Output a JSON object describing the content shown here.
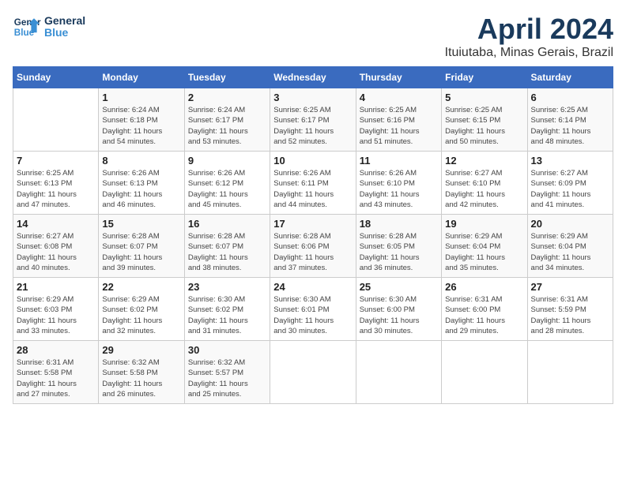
{
  "header": {
    "logo_line1": "General",
    "logo_line2": "Blue",
    "month": "April 2024",
    "location": "Ituiutaba, Minas Gerais, Brazil"
  },
  "days_of_week": [
    "Sunday",
    "Monday",
    "Tuesday",
    "Wednesday",
    "Thursday",
    "Friday",
    "Saturday"
  ],
  "weeks": [
    [
      {
        "day": "",
        "text": ""
      },
      {
        "day": "1",
        "text": "Sunrise: 6:24 AM\nSunset: 6:18 PM\nDaylight: 11 hours\nand 54 minutes."
      },
      {
        "day": "2",
        "text": "Sunrise: 6:24 AM\nSunset: 6:17 PM\nDaylight: 11 hours\nand 53 minutes."
      },
      {
        "day": "3",
        "text": "Sunrise: 6:25 AM\nSunset: 6:17 PM\nDaylight: 11 hours\nand 52 minutes."
      },
      {
        "day": "4",
        "text": "Sunrise: 6:25 AM\nSunset: 6:16 PM\nDaylight: 11 hours\nand 51 minutes."
      },
      {
        "day": "5",
        "text": "Sunrise: 6:25 AM\nSunset: 6:15 PM\nDaylight: 11 hours\nand 50 minutes."
      },
      {
        "day": "6",
        "text": "Sunrise: 6:25 AM\nSunset: 6:14 PM\nDaylight: 11 hours\nand 48 minutes."
      }
    ],
    [
      {
        "day": "7",
        "text": "Sunrise: 6:25 AM\nSunset: 6:13 PM\nDaylight: 11 hours\nand 47 minutes."
      },
      {
        "day": "8",
        "text": "Sunrise: 6:26 AM\nSunset: 6:13 PM\nDaylight: 11 hours\nand 46 minutes."
      },
      {
        "day": "9",
        "text": "Sunrise: 6:26 AM\nSunset: 6:12 PM\nDaylight: 11 hours\nand 45 minutes."
      },
      {
        "day": "10",
        "text": "Sunrise: 6:26 AM\nSunset: 6:11 PM\nDaylight: 11 hours\nand 44 minutes."
      },
      {
        "day": "11",
        "text": "Sunrise: 6:26 AM\nSunset: 6:10 PM\nDaylight: 11 hours\nand 43 minutes."
      },
      {
        "day": "12",
        "text": "Sunrise: 6:27 AM\nSunset: 6:10 PM\nDaylight: 11 hours\nand 42 minutes."
      },
      {
        "day": "13",
        "text": "Sunrise: 6:27 AM\nSunset: 6:09 PM\nDaylight: 11 hours\nand 41 minutes."
      }
    ],
    [
      {
        "day": "14",
        "text": "Sunrise: 6:27 AM\nSunset: 6:08 PM\nDaylight: 11 hours\nand 40 minutes."
      },
      {
        "day": "15",
        "text": "Sunrise: 6:28 AM\nSunset: 6:07 PM\nDaylight: 11 hours\nand 39 minutes."
      },
      {
        "day": "16",
        "text": "Sunrise: 6:28 AM\nSunset: 6:07 PM\nDaylight: 11 hours\nand 38 minutes."
      },
      {
        "day": "17",
        "text": "Sunrise: 6:28 AM\nSunset: 6:06 PM\nDaylight: 11 hours\nand 37 minutes."
      },
      {
        "day": "18",
        "text": "Sunrise: 6:28 AM\nSunset: 6:05 PM\nDaylight: 11 hours\nand 36 minutes."
      },
      {
        "day": "19",
        "text": "Sunrise: 6:29 AM\nSunset: 6:04 PM\nDaylight: 11 hours\nand 35 minutes."
      },
      {
        "day": "20",
        "text": "Sunrise: 6:29 AM\nSunset: 6:04 PM\nDaylight: 11 hours\nand 34 minutes."
      }
    ],
    [
      {
        "day": "21",
        "text": "Sunrise: 6:29 AM\nSunset: 6:03 PM\nDaylight: 11 hours\nand 33 minutes."
      },
      {
        "day": "22",
        "text": "Sunrise: 6:29 AM\nSunset: 6:02 PM\nDaylight: 11 hours\nand 32 minutes."
      },
      {
        "day": "23",
        "text": "Sunrise: 6:30 AM\nSunset: 6:02 PM\nDaylight: 11 hours\nand 31 minutes."
      },
      {
        "day": "24",
        "text": "Sunrise: 6:30 AM\nSunset: 6:01 PM\nDaylight: 11 hours\nand 30 minutes."
      },
      {
        "day": "25",
        "text": "Sunrise: 6:30 AM\nSunset: 6:00 PM\nDaylight: 11 hours\nand 30 minutes."
      },
      {
        "day": "26",
        "text": "Sunrise: 6:31 AM\nSunset: 6:00 PM\nDaylight: 11 hours\nand 29 minutes."
      },
      {
        "day": "27",
        "text": "Sunrise: 6:31 AM\nSunset: 5:59 PM\nDaylight: 11 hours\nand 28 minutes."
      }
    ],
    [
      {
        "day": "28",
        "text": "Sunrise: 6:31 AM\nSunset: 5:58 PM\nDaylight: 11 hours\nand 27 minutes."
      },
      {
        "day": "29",
        "text": "Sunrise: 6:32 AM\nSunset: 5:58 PM\nDaylight: 11 hours\nand 26 minutes."
      },
      {
        "day": "30",
        "text": "Sunrise: 6:32 AM\nSunset: 5:57 PM\nDaylight: 11 hours\nand 25 minutes."
      },
      {
        "day": "",
        "text": ""
      },
      {
        "day": "",
        "text": ""
      },
      {
        "day": "",
        "text": ""
      },
      {
        "day": "",
        "text": ""
      }
    ]
  ]
}
